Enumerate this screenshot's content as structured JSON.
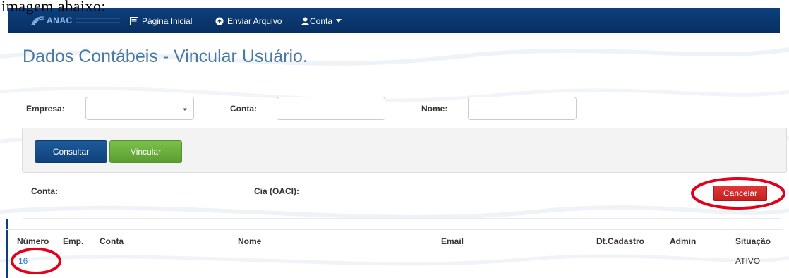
{
  "overlay_text": "imagem abaixo:",
  "navbar": {
    "brand": "ANAC",
    "items": [
      {
        "label": "Página Inicial",
        "icon": "list-icon"
      },
      {
        "label": "Enviar Arquivo",
        "icon": "circle-arrow-icon"
      },
      {
        "label": "Conta",
        "icon": "user-icon",
        "dropdown": true
      }
    ]
  },
  "page": {
    "title": "Dados Contábeis - Vincular Usuário."
  },
  "filters": {
    "empresa_label": "Empresa:",
    "empresa_value": "",
    "conta_label": "Conta:",
    "conta_value": "",
    "nome_label": "Nome:",
    "nome_value": ""
  },
  "actions": {
    "consultar": "Consultar",
    "vincular": "Vincular",
    "cancelar": "Cancelar"
  },
  "info": {
    "conta_label": "Conta:",
    "cia_label": "Cia (OACI):"
  },
  "table": {
    "columns": [
      "Número",
      "Emp.",
      "Conta",
      "Nome",
      "Email",
      "Dt.Cadastro",
      "Admin",
      "Situação"
    ],
    "rows": [
      {
        "numero": "16",
        "emp": "",
        "conta": "",
        "nome": "",
        "email": "",
        "dt_cadastro": "",
        "admin": "",
        "situacao": "ATIVO"
      }
    ]
  },
  "colors": {
    "navbar": "#0d3f7c",
    "title": "#4a7aa4",
    "btn_primary": "#1d5a9a",
    "btn_success": "#6aae3d",
    "btn_danger": "#d12a2a",
    "annotation": "#e3001b",
    "link": "#2a7ad6"
  }
}
